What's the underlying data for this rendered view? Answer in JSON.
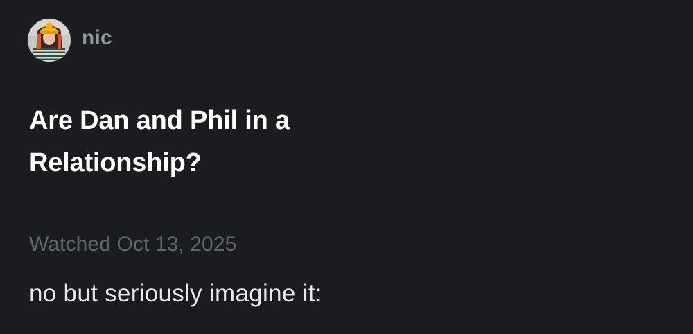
{
  "user": {
    "name": "nic",
    "avatar_icon": "user-avatar-photo"
  },
  "entry": {
    "title": "Are Dan and Phil in a Relationship?",
    "watched_label": "Watched Oct 13, 2025",
    "review_text": "no but seriously imagine it:"
  },
  "colors": {
    "background": "#1b1c1f",
    "title": "#ffffff",
    "username": "#8e959c",
    "meta": "#5e6670",
    "body": "#e6e9ee"
  }
}
